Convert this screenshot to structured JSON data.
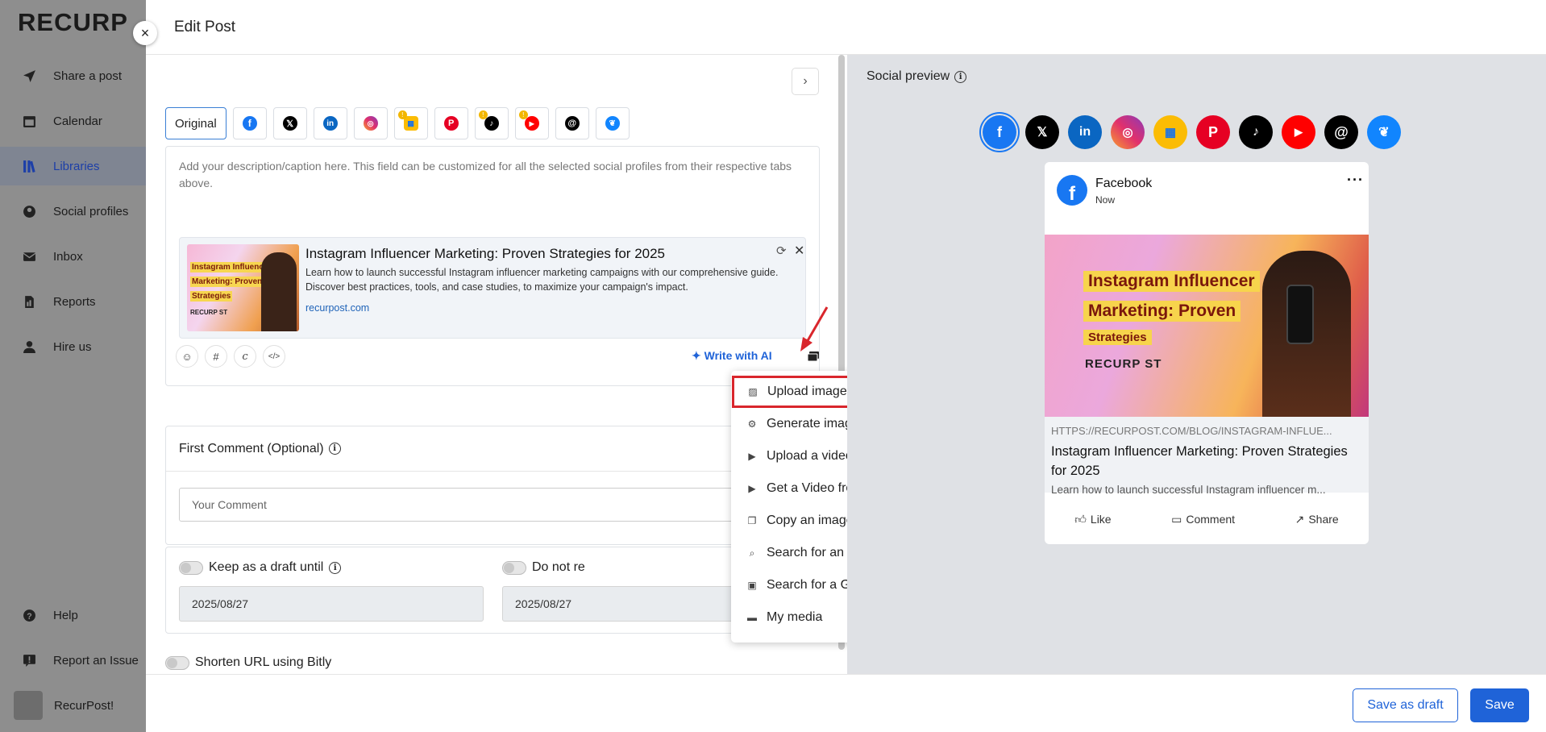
{
  "sidebar": {
    "logo": "RECURP",
    "items": [
      {
        "label": "Share a post",
        "icon": "send-icon"
      },
      {
        "label": "Calendar",
        "icon": "calendar-icon"
      },
      {
        "label": "Libraries",
        "icon": "libraries-icon",
        "active": true
      },
      {
        "label": "Social profiles",
        "icon": "profile-icon"
      },
      {
        "label": "Inbox",
        "icon": "inbox-icon"
      },
      {
        "label": "Reports",
        "icon": "report-icon"
      },
      {
        "label": "Hire us",
        "icon": "person-icon"
      }
    ],
    "bottom": [
      {
        "label": "Help",
        "icon": "help-icon"
      },
      {
        "label": "Report an Issue",
        "icon": "report-issue-icon"
      },
      {
        "label": "RecurPost!",
        "icon": "avatar"
      }
    ]
  },
  "modal": {
    "title": "Edit Post",
    "close_icon": "×"
  },
  "editor": {
    "tabs": {
      "original_label": "Original",
      "networks": [
        "facebook",
        "x",
        "linkedin",
        "instagram",
        "google-business",
        "pinterest",
        "tiktok",
        "youtube",
        "threads",
        "bluesky"
      ]
    },
    "description_placeholder": "Add your description/caption here. This field can be customized for all the selected social profiles from their respective tabs above.",
    "link_card": {
      "image_text": [
        "Instagram Influencer",
        "Marketing: Proven",
        "Strategies",
        "RECURP ST"
      ],
      "title": "Instagram Influencer Marketing: Proven Strategies for 2025",
      "description": "Learn how to launch successful Instagram influencer marketing campaigns with our comprehensive guide. Discover best practices, tools, and case studies, to maximize your campaign's impact.",
      "url": "recurpost.com"
    },
    "write_ai_label": "Write with AI",
    "first_comment": {
      "label": "First Comment (Optional)",
      "placeholder": "Your Comment"
    },
    "draft": {
      "keep_label": "Keep as a draft until",
      "keep_date": "2025/08/27",
      "do_not_label": "Do not re",
      "do_not_date": "2025/08/27"
    },
    "bitly_label": "Shorten URL using Bitly"
  },
  "media_menu": {
    "items": [
      {
        "label": "Upload images",
        "icon": "image-icon"
      },
      {
        "label": "Generate image using AI",
        "icon": "robot-icon"
      },
      {
        "label": "Upload a video",
        "icon": "video-icon"
      },
      {
        "label": "Get a Video from URL",
        "icon": "video-url-icon"
      },
      {
        "label": "Copy an image from the web",
        "icon": "copy-icon"
      },
      {
        "label": "Search for an image",
        "icon": "search-image-icon"
      },
      {
        "label": "Search for a GIF",
        "icon": "gif-icon"
      },
      {
        "label": "My media",
        "icon": "folder-icon"
      }
    ]
  },
  "preview": {
    "title": "Social preview",
    "facebook": {
      "name": "Facebook",
      "time": "Now",
      "url": "HTTPS://RECURPOST.COM/BLOG/INSTAGRAM-INFLUE...",
      "headline": "Instagram Influencer Marketing: Proven Strategies for 2025",
      "description": "Learn how to launch successful Instagram influencer m...",
      "image_text": [
        "Instagram Influencer",
        "Marketing: Proven",
        "Strategies",
        "RECURP ST"
      ],
      "actions": [
        "Like",
        "Comment",
        "Share"
      ]
    }
  },
  "footer": {
    "save_draft_label": "Save as draft",
    "save_label": "Save"
  },
  "colors": {
    "primary": "#1f63d8",
    "highlight": "#d9262c",
    "facebook": "#1877f2"
  }
}
